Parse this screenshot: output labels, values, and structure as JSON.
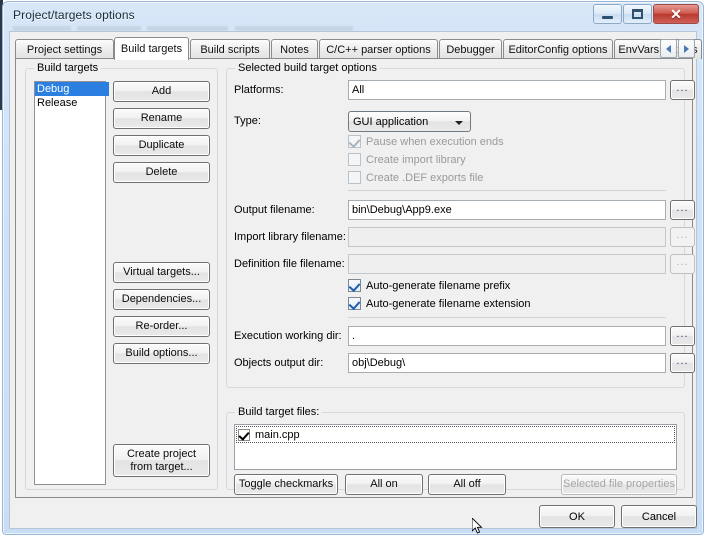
{
  "window": {
    "title": "Project/targets options",
    "buttons": {
      "minimize": "minimize",
      "maximize": "maximize",
      "close": "✕"
    }
  },
  "tabs": {
    "items": [
      {
        "label": "Project settings",
        "selected": false
      },
      {
        "label": "Build targets",
        "selected": true
      },
      {
        "label": "Build scripts",
        "selected": false
      },
      {
        "label": "Notes",
        "selected": false
      },
      {
        "label": "C/C++ parser options",
        "selected": false
      },
      {
        "label": "Debugger",
        "selected": false
      },
      {
        "label": "EditorConfig options",
        "selected": false
      },
      {
        "label": "EnvVars options",
        "selected": false
      }
    ],
    "scroll_left": "◄",
    "scroll_right": "►"
  },
  "build_targets_group": {
    "label": "Build targets",
    "list": [
      {
        "name": "Debug",
        "selected": true
      },
      {
        "name": "Release",
        "selected": false
      }
    ],
    "buttons": {
      "add": "Add",
      "rename": "Rename",
      "duplicate": "Duplicate",
      "delete": "Delete",
      "virtual_targets": "Virtual targets...",
      "dependencies": "Dependencies...",
      "reorder": "Re-order...",
      "build_options": "Build options...",
      "create_project_line1": "Create project",
      "create_project_line2": "from target..."
    }
  },
  "selected_options_group": {
    "label": "Selected build target options",
    "platforms": {
      "label": "Platforms:",
      "value": "All",
      "browse": "..."
    },
    "type": {
      "label": "Type:",
      "value": "GUI application"
    },
    "type_checks": [
      {
        "label": "Pause when execution ends",
        "checked": true,
        "enabled": false
      },
      {
        "label": "Create import library",
        "checked": false,
        "enabled": false
      },
      {
        "label": "Create .DEF exports file",
        "checked": false,
        "enabled": false
      }
    ],
    "output_filename": {
      "label": "Output filename:",
      "value": "bin\\Debug\\App9.exe",
      "browse": "...",
      "enabled": true
    },
    "import_library_filename": {
      "label": "Import library filename:",
      "value": "",
      "browse": "...",
      "enabled": false
    },
    "definition_file_filename": {
      "label": "Definition file filename:",
      "value": "",
      "browse": "...",
      "enabled": false
    },
    "autogen_checks": [
      {
        "label": "Auto-generate filename prefix",
        "checked": true,
        "enabled": true
      },
      {
        "label": "Auto-generate filename extension",
        "checked": true,
        "enabled": true
      }
    ],
    "execution_working_dir": {
      "label": "Execution working dir:",
      "value": ".",
      "browse": "...",
      "enabled": true
    },
    "objects_output_dir": {
      "label": "Objects output dir:",
      "value": "obj\\Debug\\",
      "browse": "...",
      "enabled": true
    }
  },
  "build_target_files_group": {
    "label": "Build target files:",
    "files": [
      {
        "name": "main.cpp",
        "checked": true,
        "focused": true
      }
    ],
    "buttons": {
      "toggle_checkmarks": "Toggle checkmarks",
      "all_on": "All on",
      "all_off": "All off",
      "selected_file_properties": "Selected file properties"
    }
  },
  "footer": {
    "ok": "OK",
    "cancel": "Cancel"
  }
}
